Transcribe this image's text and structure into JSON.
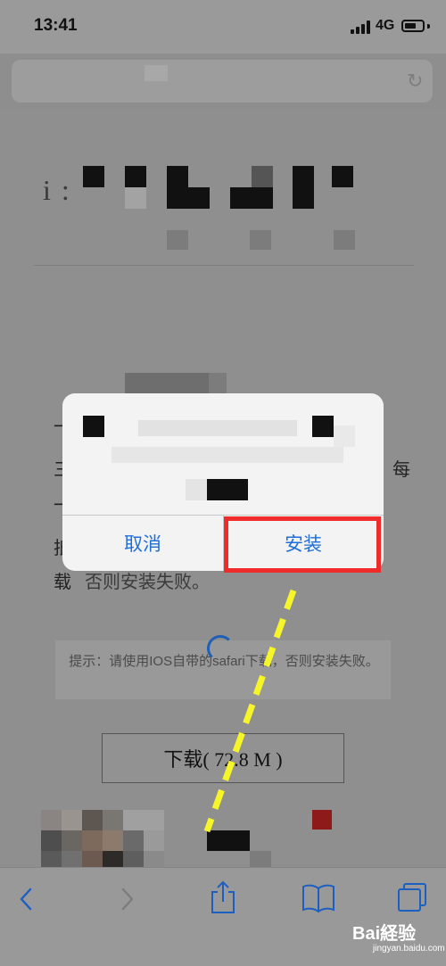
{
  "status_bar": {
    "time": "13:41",
    "network": "4G"
  },
  "page": {
    "heading_fragment": "i  :",
    "line_1": "一",
    "line_2": "三",
    "line_3": "一",
    "line_4": "抵",
    "line_5": "载",
    "line_5_tail": "否则安装失败。",
    "tip_text": "提示：请使用IOS自带的safari下载，否则安装失败。",
    "download_label": "下载( 72.8 M )"
  },
  "dialog": {
    "cancel_label": "取消",
    "install_label": "安装"
  },
  "toolbar": {
    "icons": [
      "back-icon",
      "forward-icon",
      "share-icon",
      "bookmarks-icon",
      "tabs-icon"
    ]
  },
  "watermark": {
    "brand": "Bai経验",
    "url": "jingyan.baidu.com"
  },
  "annotation": {
    "highlight_color": "#ef2b2b",
    "arrow_color": "#f5f52a"
  }
}
